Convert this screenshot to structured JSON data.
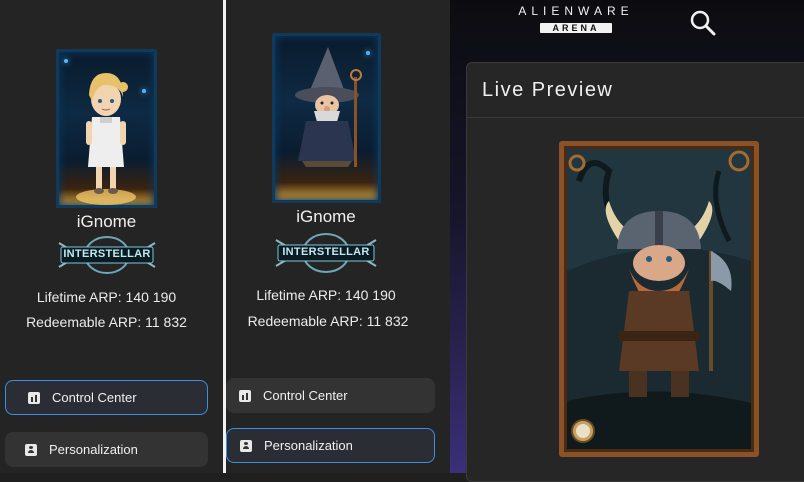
{
  "profile_a": {
    "username": "iGnome",
    "badge": "INTERSTELLAR",
    "lifetime_arp": "Lifetime ARP: 140 190",
    "redeemable_arp": "Redeemable ARP: 11 832",
    "avatar": "blonde-girl-avatar"
  },
  "profile_b": {
    "username": "iGnome",
    "badge": "INTERSTELLAR",
    "lifetime_arp": "Lifetime ARP: 140 190",
    "redeemable_arp": "Redeemable ARP: 11 832",
    "avatar": "wizard-avatar"
  },
  "menu_a": {
    "items": [
      {
        "label": "Control Center",
        "icon": "chart-icon",
        "active": true
      },
      {
        "label": "Personalization",
        "icon": "person-icon",
        "active": false
      }
    ]
  },
  "menu_b": {
    "items": [
      {
        "label": "Control Center",
        "icon": "chart-icon",
        "active": false
      },
      {
        "label": "Personalization",
        "icon": "person-icon",
        "active": true
      }
    ]
  },
  "header": {
    "brand": "ALIENWARE",
    "brand_sub": "ARENA",
    "search_icon": "search-icon"
  },
  "live_preview": {
    "title": "Live Preview",
    "image": "viking-dwarf-avatar"
  },
  "colors": {
    "accent": "#3d8fe0",
    "panel_bg": "#242424",
    "button_bg": "#333333"
  }
}
